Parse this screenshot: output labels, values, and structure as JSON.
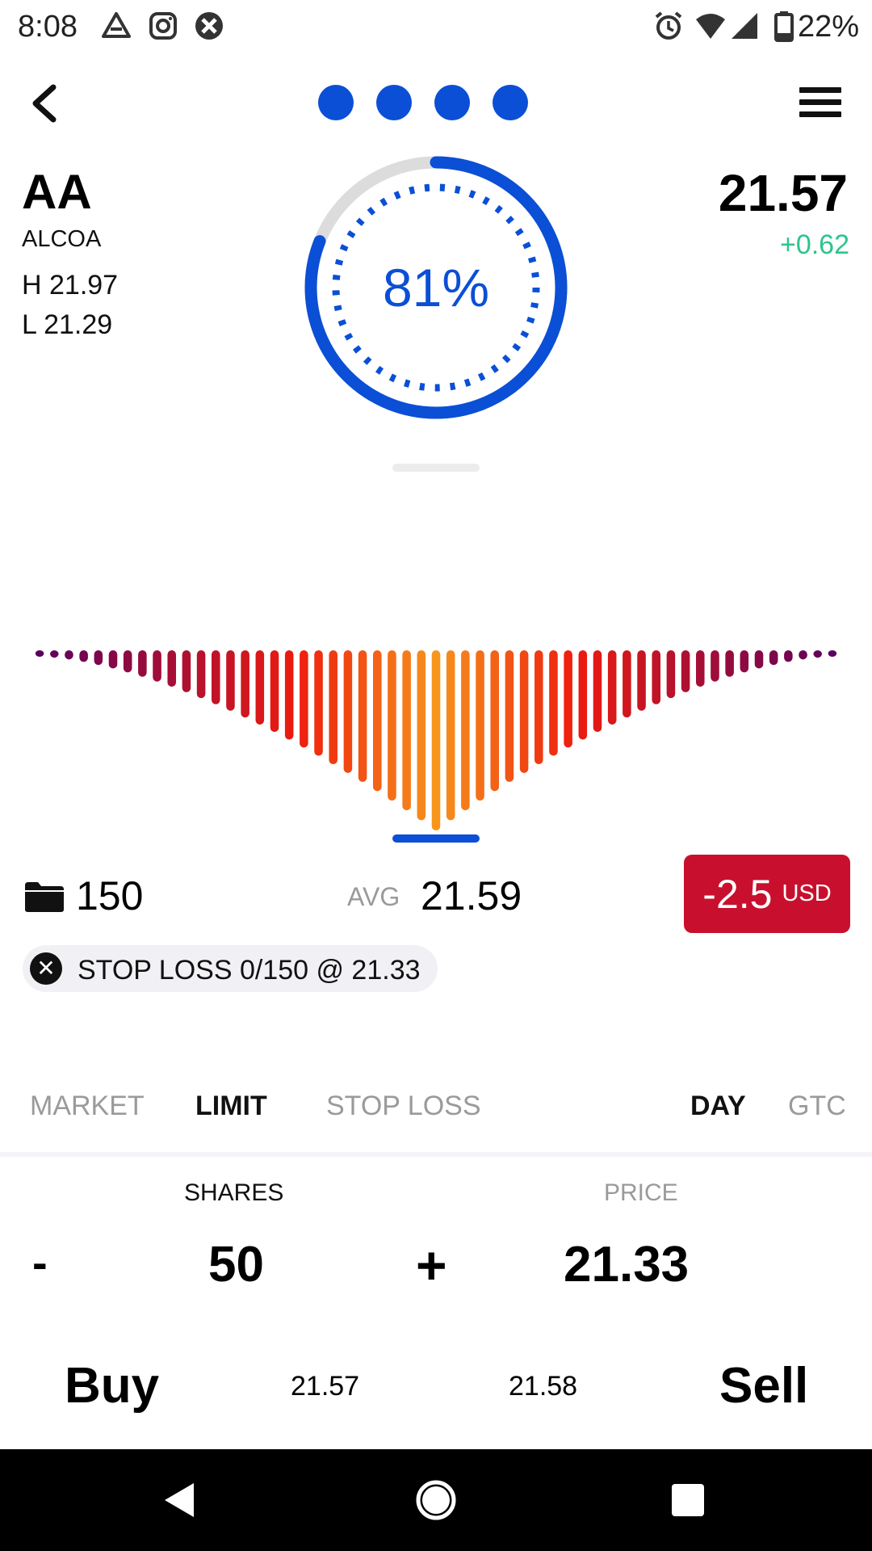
{
  "status_bar": {
    "time": "8:08",
    "battery": "22%",
    "left_icons": [
      "drive-icon",
      "instagram-icon",
      "app-icon"
    ],
    "right_icons": [
      "alarm-icon",
      "wifi-icon",
      "signal-icon",
      "battery-icon"
    ]
  },
  "header": {
    "page_dot_count": 4,
    "page_dot_color": "#0a4fd6"
  },
  "ticker": {
    "symbol": "AA",
    "company": "ALCOA",
    "high": "H 21.97",
    "low": "L 21.29",
    "price": "21.57",
    "change": "+0.62",
    "change_color": "#2ec48c"
  },
  "gauge": {
    "label": "81%",
    "percent": 81,
    "color": "#0a4fd6"
  },
  "depth_chart": {
    "bar_count": 55,
    "center_color": "#f7951d",
    "mid_color": "#ee1c0e",
    "edge_color": "#5c005e",
    "underline_color": "#0a4fd6"
  },
  "position": {
    "quantity": "150",
    "avg_label": "AVG",
    "avg_price": "21.59",
    "pnl_value": "-2.5",
    "pnl_currency": "USD",
    "pnl_color": "#c8102e"
  },
  "stop_loss_chip": {
    "text": "STOP LOSS 0/150 @ 21.33"
  },
  "order_tabs": [
    {
      "label": "MARKET",
      "active": false
    },
    {
      "label": "LIMIT",
      "active": true
    },
    {
      "label": "STOP LOSS",
      "active": false
    }
  ],
  "duration_tabs": [
    {
      "label": "DAY",
      "active": true
    },
    {
      "label": "GTC",
      "active": false
    }
  ],
  "order": {
    "shares_label": "SHARES",
    "price_label": "PRICE",
    "minus": "-",
    "plus": "+",
    "shares": "50",
    "price": "21.33"
  },
  "actions": {
    "buy_label": "Buy",
    "bid": "21.57",
    "ask": "21.58",
    "sell_label": "Sell"
  }
}
